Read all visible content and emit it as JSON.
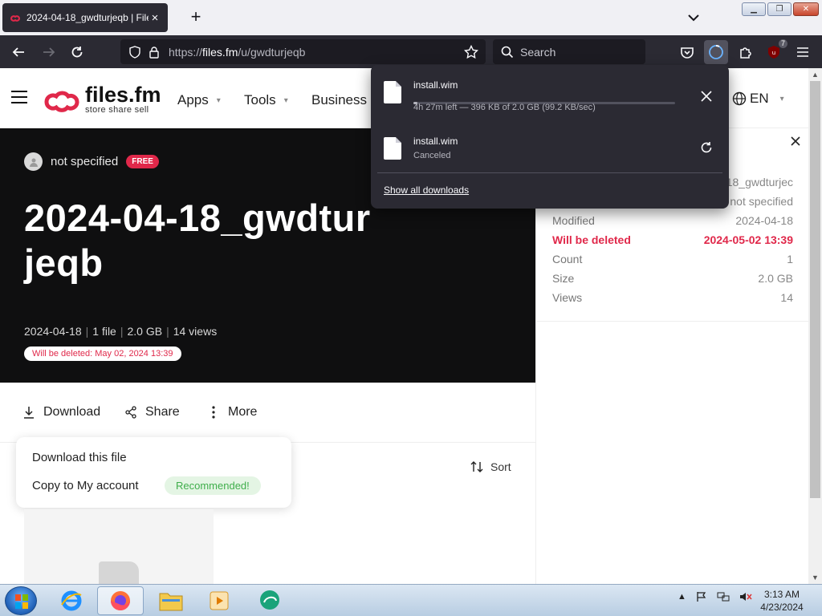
{
  "browser": {
    "tab": {
      "title": "2024-04-18_gwdturjeqb | Files.fm",
      "close_glyph": "×"
    },
    "new_tab_glyph": "+",
    "window_buttons": {
      "minimize": "▁",
      "restore": "❐",
      "close": "✕"
    },
    "url": {
      "prefix": "https://",
      "host": "files.fm",
      "path": "/u/gwdturjeqb"
    },
    "search_placeholder": "Search",
    "extensions_badge": "7"
  },
  "site": {
    "logo": {
      "name": "files.fm",
      "tagline": "store  share  sell",
      "color": "#e0284a"
    },
    "nav": [
      {
        "label": "Apps"
      },
      {
        "label": "Tools"
      },
      {
        "label": "Business"
      }
    ],
    "language": "EN",
    "caret": "▾"
  },
  "hero": {
    "owner": "not specified",
    "plan_badge": "FREE",
    "title": "2024-04-18_gwdturjeqb",
    "meta": {
      "date": "2024-04-18",
      "files": "1 file",
      "size": "2.0 GB",
      "views": "14 views",
      "sep": "|"
    },
    "delete_notice": "Will be deleted: May 02, 2024 13:39"
  },
  "actions": {
    "download": "Download",
    "share": "Share",
    "more": "More"
  },
  "download_menu": {
    "download_file": "Download this file",
    "copy_account": "Copy to My account",
    "recommended": "Recommended!"
  },
  "sort_label": "Sort",
  "sidebar": {
    "rows": [
      {
        "key": "",
        "value": "18_gwdturjec"
      },
      {
        "key": "",
        "value": "not specified"
      },
      {
        "key": "Modified",
        "value": "2024-04-18"
      },
      {
        "key": "Will be deleted",
        "value": "2024-05-02 13:39",
        "warn": true
      },
      {
        "key": "Count",
        "value": "1"
      },
      {
        "key": "Size",
        "value": "2.0 GB"
      },
      {
        "key": "Views",
        "value": "14"
      }
    ]
  },
  "downloads": {
    "items": [
      {
        "name": "install.wim",
        "status": "4h 27m left — 396 KB of 2.0 GB (99.2 KB/sec)",
        "progress_percent": 0.02
      },
      {
        "name": "install.wim",
        "status": "Canceled"
      }
    ],
    "show_all": "Show all downloads"
  },
  "taskbar": {
    "clock_time": "3:13 AM",
    "clock_date": "4/23/2024"
  },
  "colors": {
    "brand_red": "#e0284a",
    "browser_dark": "#2b2a33",
    "hero_bg": "#0f0f10",
    "recommended_green": "#3fae4b"
  }
}
